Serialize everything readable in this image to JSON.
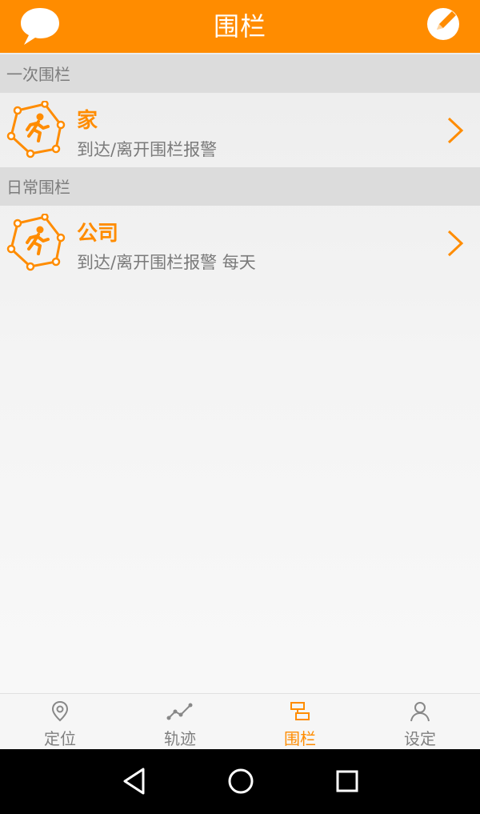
{
  "header": {
    "title": "围栏",
    "left_icon": "chat-bubble-icon",
    "right_icon": "edit-pencil-icon"
  },
  "sections": [
    {
      "label": "一次围栏",
      "items": [
        {
          "name": "家",
          "description": "到达/离开围栏报警",
          "icon": "fence-runner-icon"
        }
      ]
    },
    {
      "label": "日常围栏",
      "items": [
        {
          "name": "公司",
          "description": "到达/离开围栏报警 每天",
          "icon": "fence-runner-icon"
        }
      ]
    }
  ],
  "tabs": [
    {
      "label": "定位",
      "icon": "location-pin-icon",
      "active": false
    },
    {
      "label": "轨迹",
      "icon": "track-line-icon",
      "active": false
    },
    {
      "label": "围栏",
      "icon": "fence-icon",
      "active": true
    },
    {
      "label": "设定",
      "icon": "person-icon",
      "active": false
    }
  ],
  "navbar": {
    "buttons": [
      "back-triangle-icon",
      "home-circle-icon",
      "recents-square-icon"
    ]
  },
  "colors": {
    "accent": "#ff8c00",
    "section_bg": "#dcdcdc",
    "text_gray": "#7a7a7a",
    "navbar_bg": "#000000"
  }
}
